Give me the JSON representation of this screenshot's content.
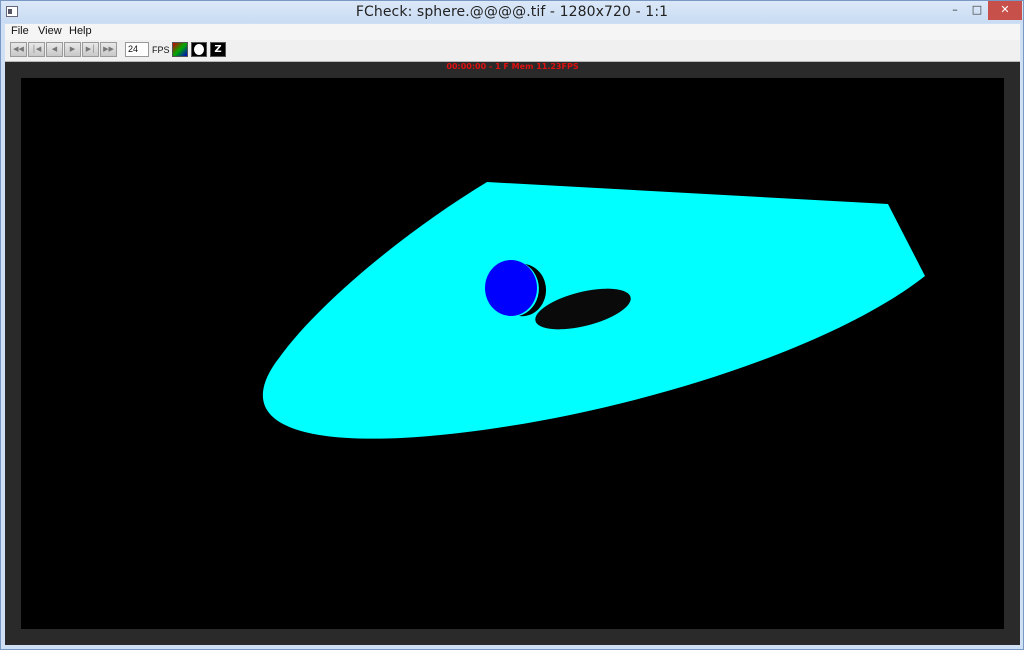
{
  "window": {
    "title": "FCheck: sphere.@@@@.tif - 1280x720 - 1:1",
    "controls": {
      "minimize": "–",
      "maximize": "□",
      "close": "✕"
    }
  },
  "menu": {
    "file": "File",
    "view": "View",
    "help": "Help"
  },
  "toolbar": {
    "playback_icons": [
      "rewind-to-start-icon",
      "step-back-icon",
      "play-backward-icon",
      "play-forward-icon",
      "step-forward-icon",
      "fast-forward-to-end-icon"
    ],
    "fps_value": "24",
    "fps_label": "FPS",
    "mode_icons": [
      "rgb-channels-icon",
      "alpha-channel-icon",
      "z-depth-icon"
    ],
    "z_glyph": "Z"
  },
  "viewer": {
    "status": "00:00:00 - 1 F Mem 11.23FPS",
    "status_color": "#e01010",
    "background_color": "#000000",
    "plane_color": "#00ffff",
    "sphere_color": "#0000ff",
    "shadow_color": "#0a0a0a"
  }
}
